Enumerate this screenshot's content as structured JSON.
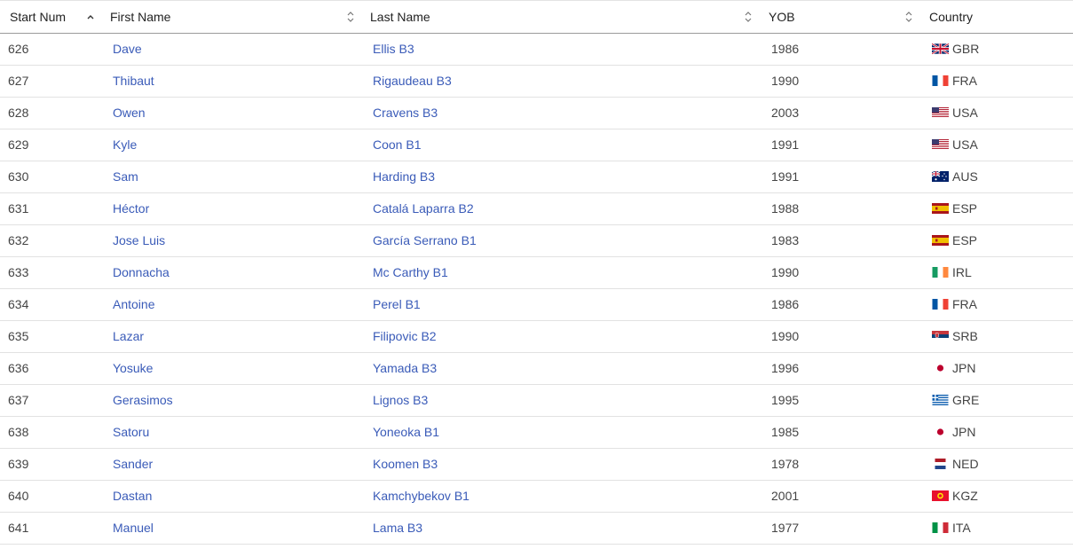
{
  "table": {
    "columns": [
      {
        "key": "start_num",
        "label": "Start Num",
        "sort": "asc"
      },
      {
        "key": "first_name",
        "label": "First Name",
        "sort": "none"
      },
      {
        "key": "last_name",
        "label": "Last Name",
        "sort": "none"
      },
      {
        "key": "yob",
        "label": "YOB",
        "sort": "none"
      },
      {
        "key": "country",
        "label": "Country",
        "sort": "none"
      }
    ],
    "rows": [
      {
        "start_num": "626",
        "first_name": "Dave",
        "last_name": "Ellis B3",
        "yob": "1986",
        "country": "GBR",
        "flag": "gbr-flag-icon"
      },
      {
        "start_num": "627",
        "first_name": "Thibaut",
        "last_name": "Rigaudeau B3",
        "yob": "1990",
        "country": "FRA",
        "flag": "fra-flag-icon"
      },
      {
        "start_num": "628",
        "first_name": "Owen",
        "last_name": "Cravens B3",
        "yob": "2003",
        "country": "USA",
        "flag": "usa-flag-icon"
      },
      {
        "start_num": "629",
        "first_name": "Kyle",
        "last_name": "Coon B1",
        "yob": "1991",
        "country": "USA",
        "flag": "usa-flag-icon"
      },
      {
        "start_num": "630",
        "first_name": "Sam",
        "last_name": "Harding B3",
        "yob": "1991",
        "country": "AUS",
        "flag": "aus-flag-icon"
      },
      {
        "start_num": "631",
        "first_name": "Héctor",
        "last_name": "Catalá Laparra B2",
        "yob": "1988",
        "country": "ESP",
        "flag": "esp-flag-icon"
      },
      {
        "start_num": "632",
        "first_name": "Jose Luis",
        "last_name": "García Serrano B1",
        "yob": "1983",
        "country": "ESP",
        "flag": "esp-flag-icon"
      },
      {
        "start_num": "633",
        "first_name": "Donnacha",
        "last_name": "Mc Carthy B1",
        "yob": "1990",
        "country": "IRL",
        "flag": "irl-flag-icon"
      },
      {
        "start_num": "634",
        "first_name": "Antoine",
        "last_name": "Perel B1",
        "yob": "1986",
        "country": "FRA",
        "flag": "fra-flag-icon"
      },
      {
        "start_num": "635",
        "first_name": "Lazar",
        "last_name": "Filipovic B2",
        "yob": "1990",
        "country": "SRB",
        "flag": "srb-flag-icon"
      },
      {
        "start_num": "636",
        "first_name": "Yosuke",
        "last_name": "Yamada B3",
        "yob": "1996",
        "country": "JPN",
        "flag": "jpn-flag-icon"
      },
      {
        "start_num": "637",
        "first_name": "Gerasimos",
        "last_name": "Lignos B3",
        "yob": "1995",
        "country": "GRE",
        "flag": "gre-flag-icon"
      },
      {
        "start_num": "638",
        "first_name": "Satoru",
        "last_name": "Yoneoka B1",
        "yob": "1985",
        "country": "JPN",
        "flag": "jpn-flag-icon"
      },
      {
        "start_num": "639",
        "first_name": "Sander",
        "last_name": "Koomen B3",
        "yob": "1978",
        "country": "NED",
        "flag": "ned-flag-icon"
      },
      {
        "start_num": "640",
        "first_name": "Dastan",
        "last_name": "Kamchybekov B1",
        "yob": "2001",
        "country": "KGZ",
        "flag": "kgz-flag-icon"
      },
      {
        "start_num": "641",
        "first_name": "Manuel",
        "last_name": "Lama B3",
        "yob": "1977",
        "country": "ITA",
        "flag": "ita-flag-icon"
      }
    ]
  },
  "colors": {
    "link": "#3a5bb8",
    "text": "#444444",
    "header_border": "#9a9a9a",
    "row_border": "#e2e2e2"
  }
}
